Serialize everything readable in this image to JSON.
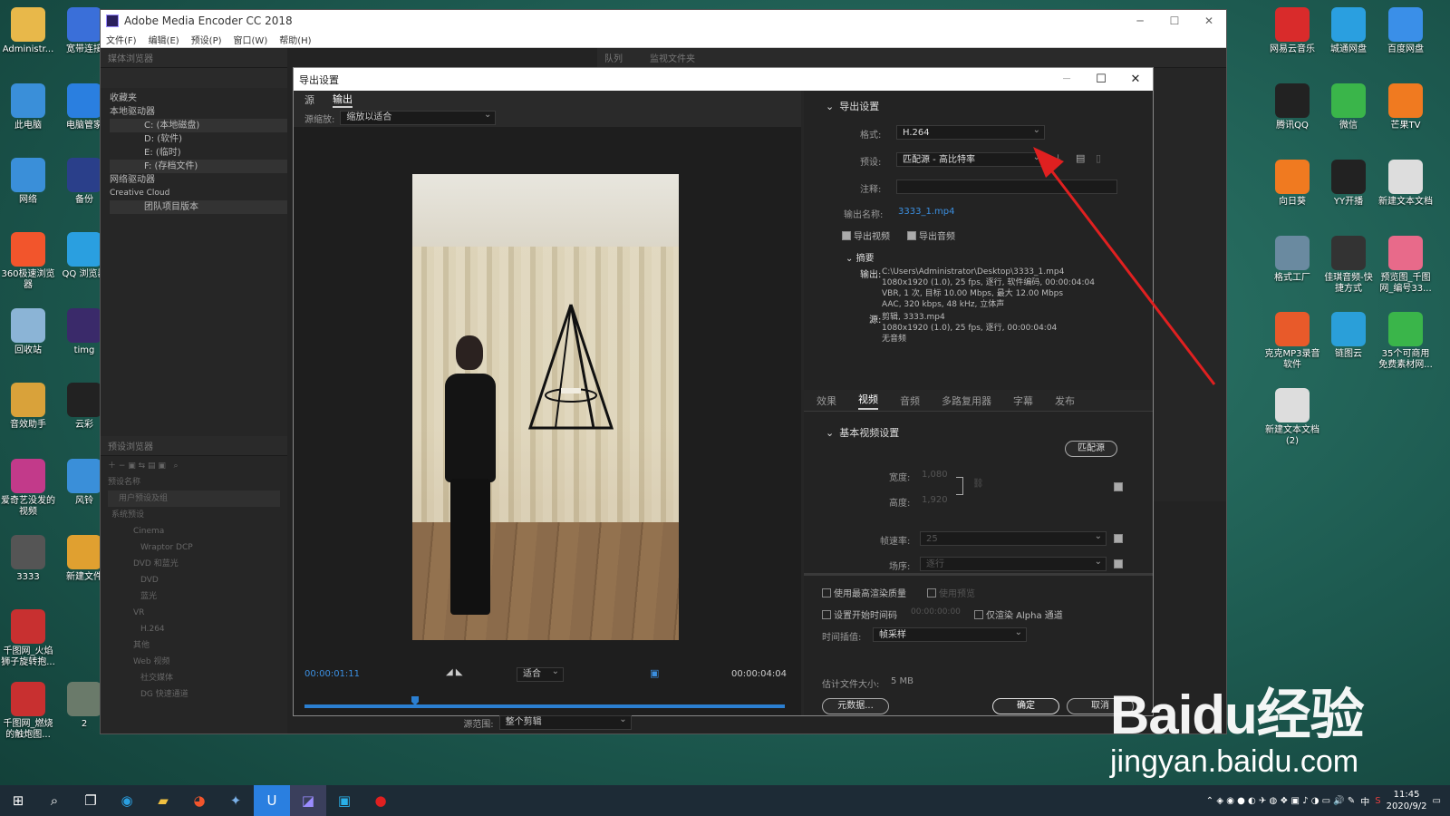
{
  "desktop_left_icons": [
    {
      "label": "Administr...",
      "color": "#e8b84a"
    },
    {
      "label": "此电脑",
      "color": "#3a8fd9"
    },
    {
      "label": "网络",
      "color": "#3a8fd9"
    },
    {
      "label": "360极速浏览器",
      "color": "#f2552c"
    },
    {
      "label": "回收站",
      "color": "#8bb4d6"
    },
    {
      "label": "音效助手",
      "color": "#d9a23a"
    },
    {
      "label": "爱奇艺没发的视频",
      "color": "#c23a8a"
    },
    {
      "label": "3333",
      "color": "#555555"
    },
    {
      "label": "千图网_火焰狮子旋转抱...",
      "color": "#c83030"
    },
    {
      "label": "千图网_燃烧的触炮图...",
      "color": "#c83030"
    }
  ],
  "desktop_col2_icons": [
    {
      "label": "宽带连接",
      "color": "#3a6fd9"
    },
    {
      "label": "电脑管家",
      "color": "#2a7fe0"
    },
    {
      "label": "备份",
      "color": "#2a3f8a"
    },
    {
      "label": "QQ 浏览器",
      "color": "#2a9fe0"
    },
    {
      "label": "timg",
      "color": "#3a2a6a"
    },
    {
      "label": "云彩",
      "color": "#222222"
    },
    {
      "label": "风铃",
      "color": "#3a8fd9"
    },
    {
      "label": "新建文件",
      "color": "#e0a030"
    },
    {
      "label": "2",
      "color": "#6a7a6a"
    }
  ],
  "desktop_right_icons": [
    {
      "label": "网易云音乐",
      "color": "#d92b2b"
    },
    {
      "label": "城通网盘",
      "color": "#2a9fe0"
    },
    {
      "label": "百度网盘",
      "color": "#3a8fe8"
    },
    {
      "label": "腾讯QQ",
      "color": "#222222"
    },
    {
      "label": "微信",
      "color": "#3ab54a"
    },
    {
      "label": "芒果TV",
      "color": "#f07a20"
    },
    {
      "label": "向日葵",
      "color": "#f07a20"
    },
    {
      "label": "YY开播",
      "color": "#222222"
    },
    {
      "label": "新建文本文档",
      "color": "#dddddd"
    },
    {
      "label": "格式工厂",
      "color": "#6a8aa0"
    },
    {
      "label": "佳琪音频-快捷方式",
      "color": "#333333"
    },
    {
      "label": "预览图_千图网_编号33...",
      "color": "#e86a8a"
    },
    {
      "label": "克克MP3录音软件",
      "color": "#e85a2a"
    },
    {
      "label": "链图云",
      "color": "#2a9fd9"
    },
    {
      "label": "35个可商用免费素材网...",
      "color": "#3ab54a"
    },
    {
      "label": "新建文本文档(2)",
      "color": "#dddddd"
    }
  ],
  "ame": {
    "title": "Adobe Media Encoder CC 2018",
    "menu": [
      "文件(F)",
      "编辑(E)",
      "预设(P)",
      "窗口(W)",
      "帮助(H)"
    ],
    "media_browser": "媒体浏览器",
    "queue": "队列",
    "watch_folders": "监视文件夹",
    "tree": [
      "收藏夹",
      "本地驱动器",
      "C: (本地磁盘)",
      "D: (软件)",
      "E: (临时)",
      "F: (存档文件)",
      "网络驱动器",
      "Creative Cloud",
      "团队项目版本"
    ],
    "preset_browser": "预设浏览器",
    "preset_name": "预设名称",
    "preset_tree": [
      "用户预设及组",
      "系统预设",
      "Cinema",
      "Wraptor DCP",
      "DVD 和蓝光",
      "DVD",
      "蓝光",
      "VR",
      "H.264",
      "其他",
      "Web 视频",
      "社交媒体",
      "DG 快速通道"
    ]
  },
  "dialog": {
    "title": "导出设置",
    "tabs": {
      "source": "源",
      "output": "输出"
    },
    "source_scale_label": "源缩放:",
    "source_scale_value": "缩放以适合",
    "time_current": "00:00:01:11",
    "time_total": "00:00:04:04",
    "fit_value": "适合",
    "range_label": "源范围:",
    "range_value": "整个剪辑",
    "export_settings": "导出设置",
    "format_label": "格式:",
    "format_value": "H.264",
    "preset_label": "预设:",
    "preset_value": "匹配源 - 高比特率",
    "comment_label": "注释:",
    "output_name_label": "输出名称:",
    "output_name_value": "3333_1.mp4",
    "export_video": "导出视频",
    "export_audio": "导出音频",
    "summary_label": "摘要",
    "output_label": "输出:",
    "output_lines": [
      "C:\\Users\\Administrator\\Desktop\\3333_1.mp4",
      "1080x1920 (1.0), 25 fps, 逐行, 软件编码, 00:00:04:04",
      "VBR, 1 次, 目标 10.00 Mbps, 最大 12.00 Mbps",
      "AAC, 320 kbps, 48 kHz, 立体声"
    ],
    "source_label": "源:",
    "source_lines": [
      "剪辑, 3333.mp4",
      "1080x1920 (1.0), 25 fps, 逐行, 00:00:04:04",
      "无音频"
    ],
    "settings_tabs": [
      "效果",
      "视频",
      "音频",
      "多路复用器",
      "字幕",
      "发布"
    ],
    "basic_video": "基本视频设置",
    "match_source_btn": "匹配源",
    "width_label": "宽度:",
    "width_value": "1,080",
    "height_label": "高度:",
    "height_value": "1,920",
    "framerate_label": "帧速率:",
    "framerate_value": "25",
    "field_order_label": "场序:",
    "field_order_value": "逐行",
    "max_render_quality": "使用最高渲染质量",
    "use_previews": "使用预览",
    "set_start_timecode": "设置开始时间码",
    "start_timecode_value": "00:00:00:00",
    "render_alpha_only": "仅渲染 Alpha 通道",
    "time_interp_label": "时间插值:",
    "time_interp_value": "帧采样",
    "est_size_label": "估计文件大小:",
    "est_size_value": "5 MB",
    "metadata_btn": "元数据...",
    "ok_btn": "确定",
    "cancel_btn": "取消"
  },
  "taskbar": {
    "time": "11:45",
    "date": "2020/9/2",
    "ime": "中"
  },
  "watermark": {
    "brand": "Baidu经验",
    "url": "jingyan.baidu.com"
  }
}
